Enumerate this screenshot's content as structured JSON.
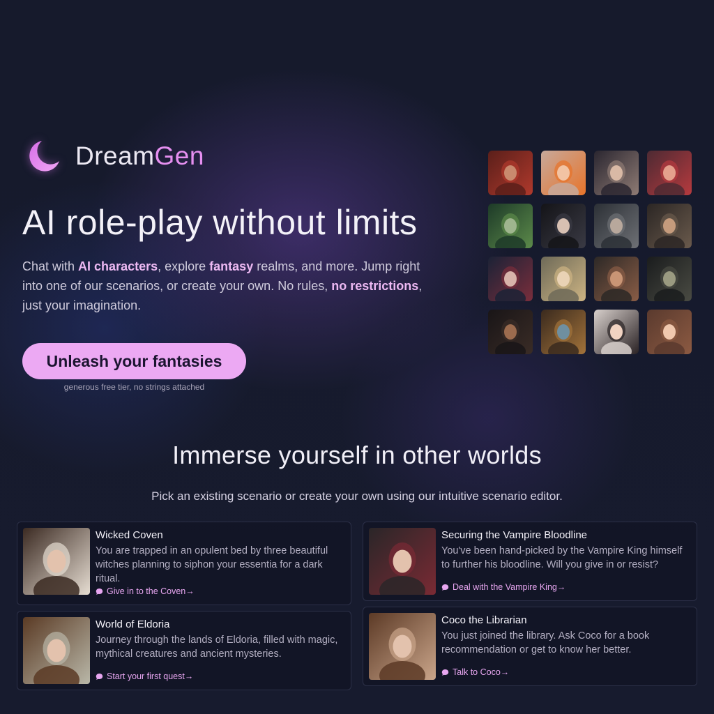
{
  "brand": {
    "name_part1": "Dream",
    "name_part2": "Gen",
    "logo_icon": "crescent-moon-icon",
    "accent": "#e58ff0"
  },
  "hero": {
    "headline": "AI role-play without limits",
    "lead_segments": [
      {
        "text": "Chat with ",
        "highlight": false
      },
      {
        "text": "AI characters",
        "highlight": true
      },
      {
        "text": ", explore ",
        "highlight": false
      },
      {
        "text": "fantasy",
        "highlight": true
      },
      {
        "text": " realms, and more. Jump right into one of our scenarios, or create your own. No rules, ",
        "highlight": false
      },
      {
        "text": "no restrictions",
        "highlight": true
      },
      {
        "text": ", just your imagination.",
        "highlight": false
      }
    ],
    "cta_label": "Unleash your fantasies",
    "cta_note": "generous free tier, no strings attached"
  },
  "character_grid": [
    {
      "name": "character-demon-man",
      "c1": "#5a1f1a",
      "c2": "#b0392c",
      "face": "#c98a6e"
    },
    {
      "name": "character-orange-hair-girl",
      "c1": "#c7a99b",
      "c2": "#e8742a",
      "face": "#f2c3a3"
    },
    {
      "name": "character-witch-trio",
      "c1": "#2a2630",
      "c2": "#8f7b74",
      "face": "#d9b9a5"
    },
    {
      "name": "character-horned-demoness",
      "c1": "#4d2a33",
      "c2": "#b63a3e",
      "face": "#e4a08c"
    },
    {
      "name": "character-forest-dryad",
      "c1": "#1d3a28",
      "c2": "#5c8a4a",
      "face": "#9fb58e"
    },
    {
      "name": "character-dark-priest",
      "c1": "#141418",
      "c2": "#3a3a44",
      "face": "#d7c0b2"
    },
    {
      "name": "character-grey-warrior",
      "c1": "#2c3036",
      "c2": "#6e7075",
      "face": "#b8a89c"
    },
    {
      "name": "character-samurai-man",
      "c1": "#2b2624",
      "c2": "#6a5a4c",
      "face": "#c59b7c"
    },
    {
      "name": "character-smoking-woman",
      "c1": "#1b2236",
      "c2": "#7a2e3c",
      "face": "#d8b3aa"
    },
    {
      "name": "character-blonde-elf",
      "c1": "#6e6a58",
      "c2": "#cdb483",
      "face": "#e9d2b5"
    },
    {
      "name": "character-tribal-warrior",
      "c1": "#2c2826",
      "c2": "#8a5d46",
      "face": "#c99575"
    },
    {
      "name": "character-goblin",
      "c1": "#1a1c1d",
      "c2": "#4a4b43",
      "face": "#9a9a80"
    },
    {
      "name": "character-dark-haired-woman",
      "c1": "#191517",
      "c2": "#3a2c26",
      "face": "#9c6b4e"
    },
    {
      "name": "character-ornate-portal",
      "c1": "#3a2a1e",
      "c2": "#a3733a",
      "face": "#6f8fa0"
    },
    {
      "name": "character-anime-girl",
      "c1": "#d8d0cc",
      "c2": "#2a2224",
      "face": "#f1d3c2"
    },
    {
      "name": "character-brunette-girl",
      "c1": "#5a3a2e",
      "c2": "#8c5a42",
      "face": "#f0c8ae"
    }
  ],
  "scenarios_section": {
    "title": "Immerse yourself in other worlds",
    "subtitle": "Pick an existing scenario or create your own using our intuitive scenario editor."
  },
  "scenarios": [
    {
      "name": "scenario-card-wicked-coven",
      "title": "Wicked Coven",
      "description": "You are trapped in an opulent bed by three beautiful witches planning to siphon your essentia for a dark ritual.",
      "link": "Give in to the Coven→",
      "image_icon": "witches-in-bed-image",
      "c1": "#3b2a22",
      "c2": "#e6ddd2"
    },
    {
      "name": "scenario-card-vampire-bloodline",
      "title": "Securing the Vampire Bloodline",
      "description": "You've been hand-picked by the Vampire King himself to further his bloodline. Will you give in or resist?",
      "link": "Deal with the Vampire King→",
      "image_icon": "vampire-king-image",
      "c1": "#2a2628",
      "c2": "#7a2a34"
    },
    {
      "name": "scenario-card-world-of-eldoria",
      "title": "World of Eldoria",
      "description": "Journey through the lands of Eldoria, filled with magic, mythical creatures and ancient mysteries.",
      "link": "Start your first quest→",
      "image_icon": "fantasy-bridge-image",
      "c1": "#5a3a24",
      "c2": "#b9b7a8"
    },
    {
      "name": "scenario-card-coco-the-librarian",
      "title": "Coco the Librarian",
      "description": "You just joined the library. Ask Coco for a book recommendation or get to know her better.",
      "link": "Talk to Coco→",
      "image_icon": "librarian-portrait-image",
      "c1": "#5c3a26",
      "c2": "#caa58a"
    }
  ]
}
